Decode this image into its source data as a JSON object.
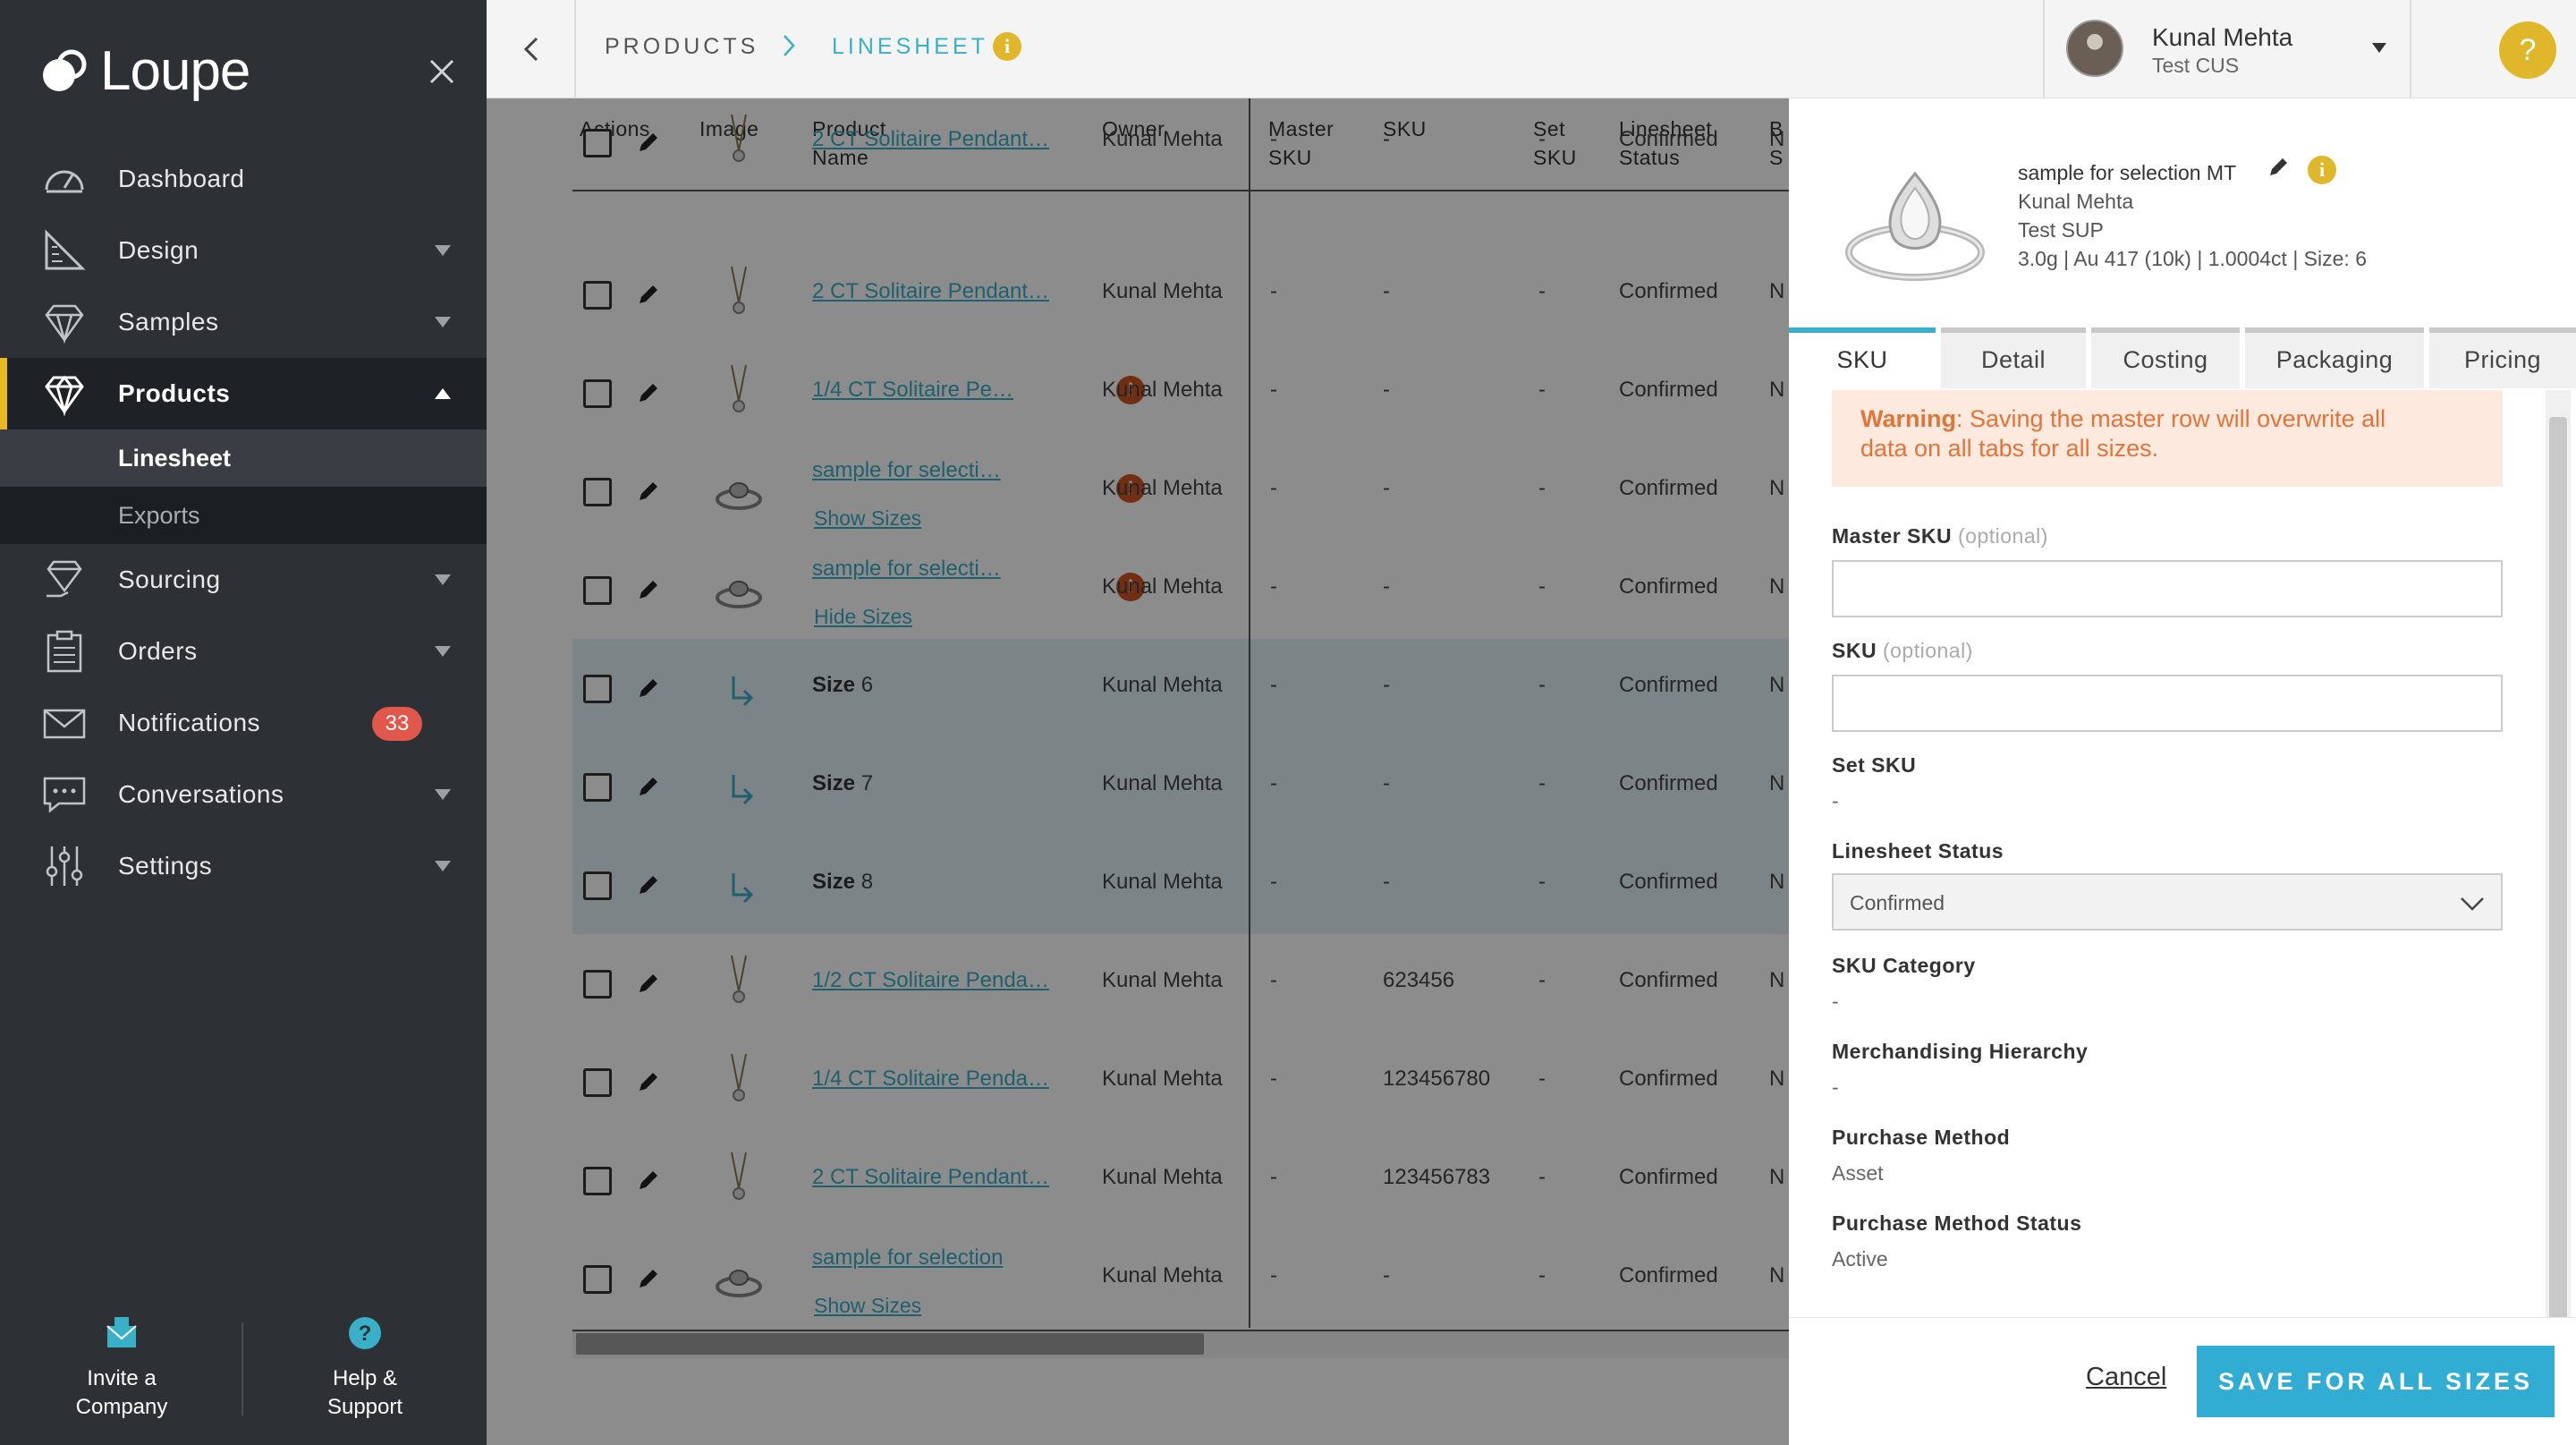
{
  "sidebar": {
    "logo": "Loupe",
    "nav": [
      {
        "label": "Dashboard",
        "icon": "speedometer-icon"
      },
      {
        "label": "Design",
        "icon": "ruler-pencil-icon"
      },
      {
        "label": "Samples",
        "icon": "diamond-outline-icon"
      },
      {
        "label": "Products",
        "icon": "diamond-icon"
      },
      {
        "label": "Sourcing",
        "icon": "diamond-hand-icon"
      },
      {
        "label": "Orders",
        "icon": "clipboard-icon"
      },
      {
        "label": "Notifications",
        "icon": "envelope-icon"
      },
      {
        "label": "Conversations",
        "icon": "chat-bubble-icon"
      },
      {
        "label": "Settings",
        "icon": "sliders-icon"
      }
    ],
    "sub_items": [
      "Linesheet",
      "Exports"
    ],
    "notifications_badge": "33",
    "invite_label_1": "Invite a",
    "invite_label_2": "Company",
    "help_label_1": "Help &",
    "help_label_2": "Support"
  },
  "topbar": {
    "crumb_1": "PRODUCTS",
    "crumb_2": "LINESHEET",
    "user_name": "Kunal Mehta",
    "user_org": "Test CUS",
    "help": "?"
  },
  "table": {
    "headers": {
      "actions": "Actions",
      "image": "Image",
      "product_name_1": "Product",
      "product_name_2": "Name",
      "owner": "Owner",
      "master_sku_1": "Master",
      "master_sku_2": "SKU",
      "sku": "SKU",
      "set_sku_1": "Set",
      "set_sku_2": "SKU",
      "status_1": "Linesheet",
      "status_2": "Status",
      "b_1": "B",
      "b_2": "S"
    },
    "rows": [
      {
        "name": "2 CT Solitaire Pendant…",
        "owner": "Kunal Mehta",
        "master": "-",
        "sku": "-",
        "set": "-",
        "status": "Confirmed",
        "b": "N"
      },
      {
        "name": "2 CT Solitaire Pendant…",
        "owner": "Kunal Mehta",
        "master": "-",
        "sku": "-",
        "set": "-",
        "status": "Confirmed",
        "b": "N"
      },
      {
        "name": "1/4 CT Solitaire Pe…",
        "owner": "Kunal Mehta",
        "master": "-",
        "sku": "-",
        "set": "-",
        "status": "Confirmed",
        "b": "N"
      },
      {
        "name": "sample for selecti…",
        "sub": "Show Sizes",
        "owner": "Kunal Mehta",
        "master": "-",
        "sku": "-",
        "set": "-",
        "status": "Confirmed",
        "b": "N"
      },
      {
        "name": "sample for selecti…",
        "sub": "Hide Sizes",
        "owner": "Kunal Mehta",
        "master": "-",
        "sku": "-",
        "set": "-",
        "status": "Confirmed",
        "b": "N"
      },
      {
        "size_word": "Size",
        "size_num": "6",
        "owner": "Kunal Mehta",
        "master": "-",
        "sku": "-",
        "set": "-",
        "status": "Confirmed",
        "b": "N"
      },
      {
        "size_word": "Size",
        "size_num": "7",
        "owner": "Kunal Mehta",
        "master": "-",
        "sku": "-",
        "set": "-",
        "status": "Confirmed",
        "b": "N"
      },
      {
        "size_word": "Size",
        "size_num": "8",
        "owner": "Kunal Mehta",
        "master": "-",
        "sku": "-",
        "set": "-",
        "status": "Confirmed",
        "b": "N"
      },
      {
        "name": "1/2 CT Solitaire Penda…",
        "owner": "Kunal Mehta",
        "master": "-",
        "sku": "623456",
        "set": "-",
        "status": "Confirmed",
        "b": "N"
      },
      {
        "name": "1/4 CT Solitaire Penda…",
        "owner": "Kunal Mehta",
        "master": "-",
        "sku": "123456780",
        "set": "-",
        "status": "Confirmed",
        "b": "N"
      },
      {
        "name": "2 CT Solitaire Pendant…",
        "owner": "Kunal Mehta",
        "master": "-",
        "sku": "123456783",
        "set": "-",
        "status": "Confirmed",
        "b": "N"
      },
      {
        "name": "sample for selection",
        "sub": "Show Sizes",
        "owner": "Kunal Mehta",
        "master": "-",
        "sku": "-",
        "set": "-",
        "status": "Confirmed",
        "b": "N"
      }
    ]
  },
  "panel": {
    "title": "sample for selection MT",
    "owner": "Kunal Mehta",
    "supplier": "Test SUP",
    "specs": "3.0g | Au 417 (10k) | 1.0004ct | Size: 6",
    "tabs": [
      "SKU",
      "Detail",
      "Costing",
      "Packaging",
      "Pricing"
    ],
    "warning_bold": "Warning",
    "warning_text_1": ": Saving the master row will overwrite all",
    "warning_text_2": "data on all tabs for all sizes.",
    "master_sku_label": "Master SKU",
    "optional": "(optional)",
    "sku_label": "SKU",
    "set_sku_label": "Set SKU",
    "set_sku_value": "-",
    "status_label": "Linesheet Status",
    "status_value": "Confirmed",
    "sku_category_label": "SKU Category",
    "sku_category_value": "-",
    "merch_label": "Merchandising Hierarchy",
    "merch_value": "-",
    "purchase_method_label": "Purchase Method",
    "purchase_method_value": "Asset",
    "purchase_status_label": "Purchase Method Status",
    "purchase_status_value": "Active",
    "cancel": "Cancel",
    "save": "SAVE FOR ALL SIZES"
  },
  "colors": {
    "accent": "#3ab0c8",
    "sidebar_bg": "#2d3136",
    "active_marker": "#e8b923",
    "badge": "#e2574c",
    "warning_bg": "#fde9dd",
    "warning_text": "#e2743a",
    "save_button": "#31acd3"
  }
}
